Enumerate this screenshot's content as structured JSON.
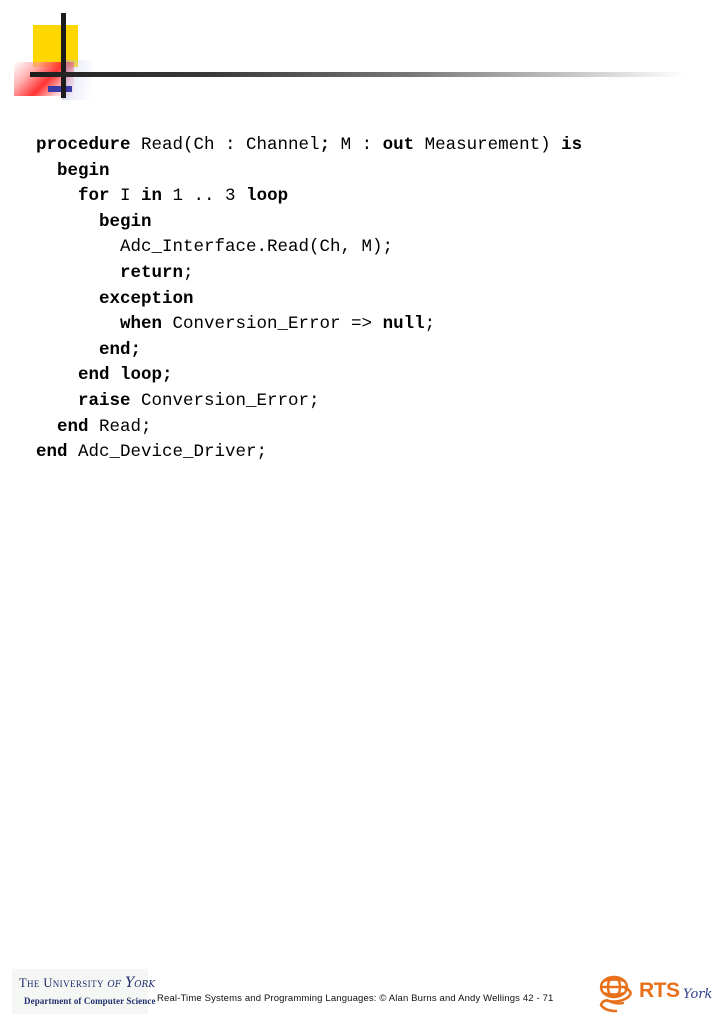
{
  "slide": {
    "header_motif": {
      "yellow": "#FFD700",
      "red": "#FF2828",
      "blue": "#3A3AA8",
      "bar": "#1C1C1C"
    },
    "code": {
      "language": "Ada",
      "lines": [
        [
          {
            "t": "procedure ",
            "b": true
          },
          {
            "t": "Read(Ch : Channel",
            "b": false
          },
          {
            "t": "; ",
            "b": true
          },
          {
            "t": "M : ",
            "b": false
          },
          {
            "t": "out ",
            "b": true
          },
          {
            "t": "Measurement) ",
            "b": false
          },
          {
            "t": "is",
            "b": true
          }
        ],
        [
          {
            "t": "  begin",
            "b": true
          }
        ],
        [
          {
            "t": "    for ",
            "b": true
          },
          {
            "t": "I ",
            "b": false
          },
          {
            "t": "in ",
            "b": true
          },
          {
            "t": "1 .. 3 ",
            "b": false
          },
          {
            "t": "loop",
            "b": true
          }
        ],
        [
          {
            "t": "      begin",
            "b": true
          }
        ],
        [
          {
            "t": "        Adc_Interface.Read(Ch, M);",
            "b": false
          }
        ],
        [
          {
            "t": "        return",
            "b": true
          },
          {
            "t": ";",
            "b": false
          }
        ],
        [
          {
            "t": "      exception",
            "b": true
          }
        ],
        [
          {
            "t": "        when ",
            "b": true
          },
          {
            "t": "Conversion_Error => ",
            "b": false
          },
          {
            "t": "null",
            "b": true
          },
          {
            "t": ";",
            "b": false
          }
        ],
        [
          {
            "t": "      end;",
            "b": true
          }
        ],
        [
          {
            "t": "    end loop;",
            "b": true
          }
        ],
        [
          {
            "t": "    raise ",
            "b": true
          },
          {
            "t": "Conversion_Error;",
            "b": false
          }
        ],
        [
          {
            "t": "  end ",
            "b": true
          },
          {
            "t": "Read;",
            "b": false
          }
        ],
        [
          {
            "t": "end ",
            "b": true
          },
          {
            "t": "Adc_Device_Driver;",
            "b": false
          }
        ]
      ]
    },
    "footer": {
      "caption": "Real-Time Systems and Programming Languages: © Alan Burns and Andy Wellings 42 - 71",
      "york_logo": {
        "line1_prefix": "The University ",
        "line1_script": "of York",
        "line2": "Department of Computer Science"
      },
      "rts_logo": {
        "acronym": "RTS",
        "suffix": "York",
        "accent_color": "#E8701A",
        "suffix_color": "#2C3E8F"
      }
    }
  }
}
